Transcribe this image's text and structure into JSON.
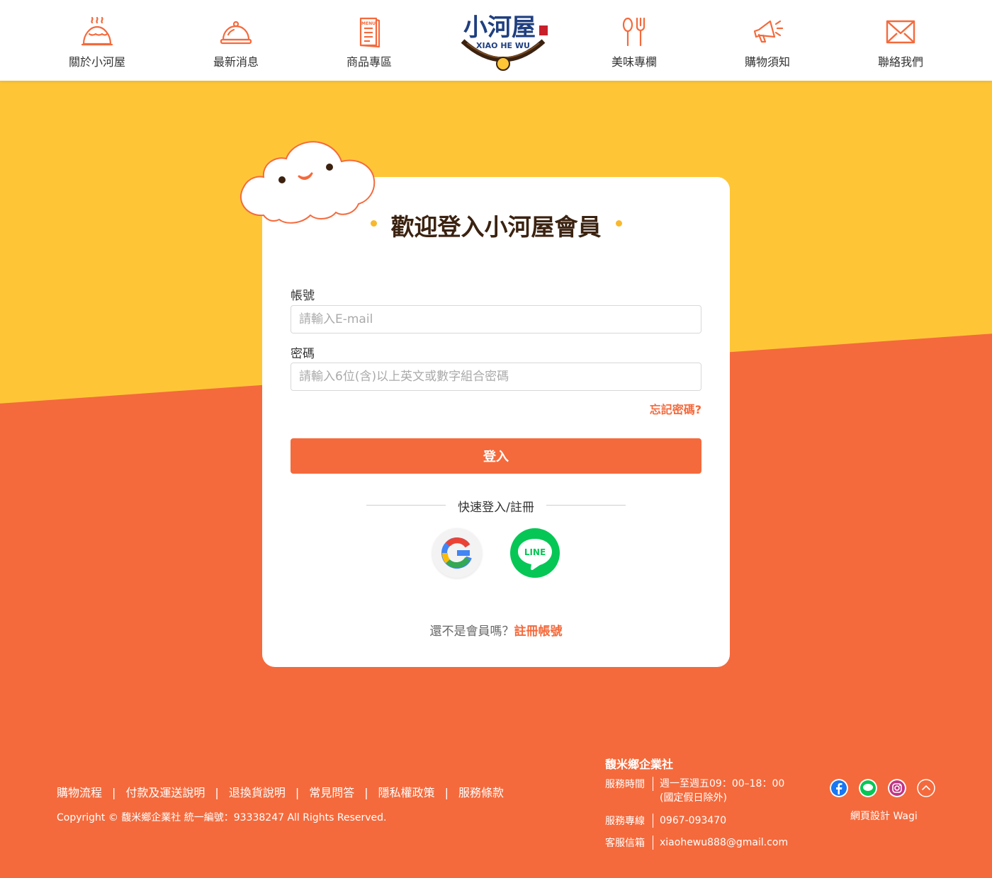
{
  "nav": {
    "items": [
      {
        "label": "關於小河屋",
        "icon": "dumpling-steam-icon"
      },
      {
        "label": "最新消息",
        "icon": "cloche-icon"
      },
      {
        "label": "商品專區",
        "icon": "menu-book-icon"
      },
      {
        "label": "美味專欄",
        "icon": "fork-spoon-icon"
      },
      {
        "label": "購物須知",
        "icon": "megaphone-icon"
      },
      {
        "label": "聯絡我們",
        "icon": "envelope-icon"
      }
    ],
    "logo": {
      "cn": "小河屋",
      "en": "XIAO HE WU"
    }
  },
  "login": {
    "title": "歡迎登入小河屋會員",
    "account_label": "帳號",
    "account_placeholder": "請輸入E-mail",
    "password_label": "密碼",
    "password_placeholder": "請輸入6位(含)以上英文或數字組合密碼",
    "forgot": "忘記密碼?",
    "submit": "登入",
    "quick": "快速登入/註冊",
    "google_icon": "google-icon",
    "line_icon": "line-icon",
    "line_text": "LINE",
    "register_prompt": "還不是會員嗎？",
    "register_link": "註冊帳號"
  },
  "footer": {
    "links": [
      "購物流程",
      "付款及運送說明",
      "退換貨說明",
      "常見問答",
      "隱私權政策",
      "服務條款"
    ],
    "separator": "|",
    "copyright": "Copyright © 馥米鄉企業社 統一編號：93338247 All Rights Reserved.",
    "company": "馥米鄉企業社",
    "hours_label": "服務時間",
    "hours_value1": "週一至週五09：00–18：00",
    "hours_value2": "(國定假日除外)",
    "phone_label": "服務專線",
    "phone_value": "0967-093470",
    "email_label": "客服信箱",
    "email_value": "xiaohewu888@gmail.com",
    "social": [
      "facebook-icon",
      "line-icon",
      "instagram-icon",
      "back-to-top-icon"
    ],
    "credit": "網頁設計 Wagi"
  },
  "colors": {
    "accent": "#F46A3C",
    "yellow": "#FEC637",
    "line_green": "#06C755",
    "title_brown": "#3b2210"
  }
}
